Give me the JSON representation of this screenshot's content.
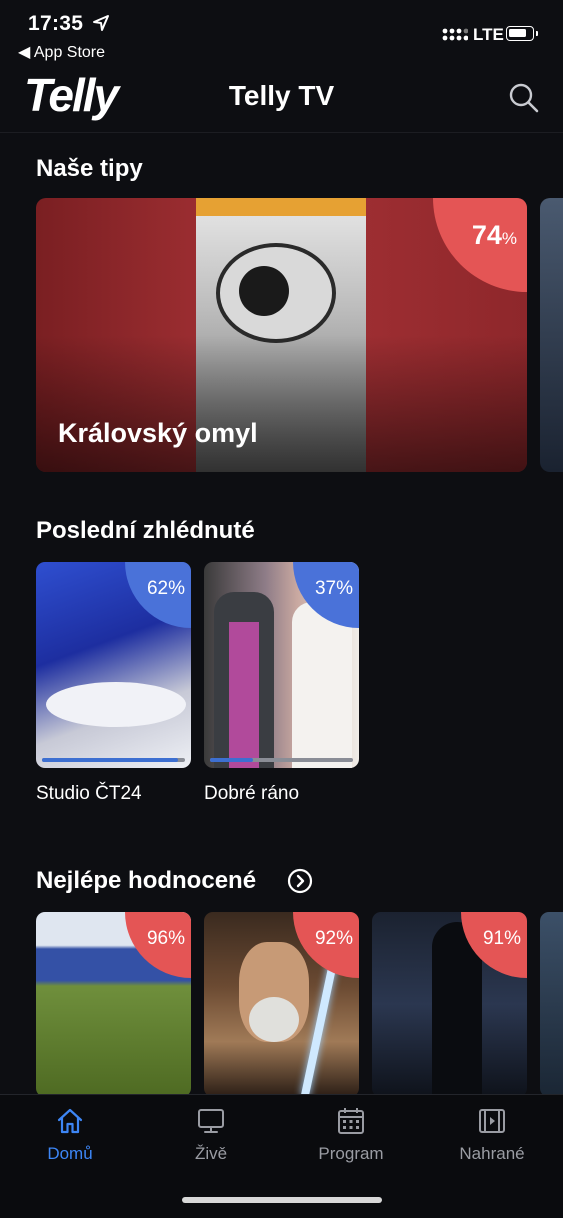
{
  "status_bar": {
    "time": "17:35",
    "back_app": "◀ App Store",
    "network": "LTE"
  },
  "header": {
    "logo": "Telly",
    "title": "Telly TV",
    "search_icon": "search-icon"
  },
  "sections": {
    "tips": {
      "title": "Naše tipy",
      "featured": {
        "title": "Královský omyl",
        "rating_value": "74",
        "rating_unit": "%"
      }
    },
    "recent": {
      "title": "Poslední zhlédnuté",
      "items": [
        {
          "label": "Studio ČT24",
          "badge": "62%",
          "progress": 0.95
        },
        {
          "label": "Dobré ráno",
          "badge": "37%",
          "progress": 0.3
        }
      ]
    },
    "top_rated": {
      "title": "Nejlépe hodnocené",
      "items": [
        {
          "badge": "96%"
        },
        {
          "badge": "92%"
        },
        {
          "badge": "91%"
        }
      ]
    }
  },
  "tabbar": {
    "items": [
      {
        "label": "Domů",
        "icon": "home-icon",
        "active": true
      },
      {
        "label": "Živě",
        "icon": "tv-icon",
        "active": false
      },
      {
        "label": "Program",
        "icon": "calendar-icon",
        "active": false
      },
      {
        "label": "Nahrané",
        "icon": "film-icon",
        "active": false
      }
    ]
  },
  "colors": {
    "background": "#0d0e12",
    "accent_blue": "#3d86f5",
    "rating_red": "#e45555",
    "recent_badge_blue": "#4a72d9"
  }
}
